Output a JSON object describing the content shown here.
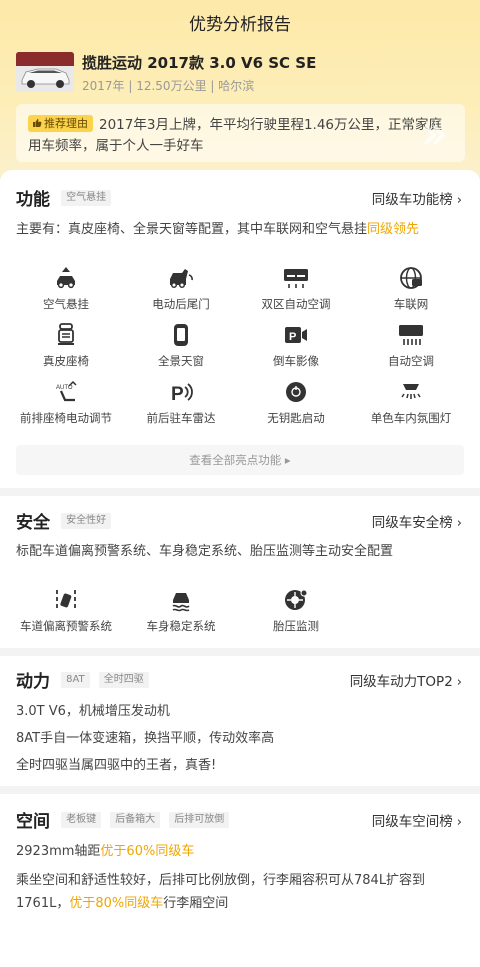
{
  "page": {
    "title": "优势分析报告"
  },
  "car": {
    "name": "揽胜运动 2017款 3.0 V6 SC SE",
    "meta": "2017年 | 12.50万公里 | 哈尔滨"
  },
  "reason": {
    "tag": "推荐理由",
    "text": "2017年3月上牌，年平均行驶里程1.46万公里，正常家庭用车频率，属于个人一手好车"
  },
  "sections": {
    "function": {
      "title": "功能",
      "chips": [
        "空气悬挂"
      ],
      "rank": "同级车功能榜",
      "desc_prefix": "主要有：真皮座椅、全景天窗等配置，其中车联网和空气悬挂",
      "desc_highlight": "同级领先",
      "items": [
        {
          "label": "空气悬挂",
          "icon": "air-suspension-icon"
        },
        {
          "label": "电动后尾门",
          "icon": "power-tailgate-icon"
        },
        {
          "label": "双区自动空调",
          "icon": "dual-zone-ac-icon"
        },
        {
          "label": "车联网",
          "icon": "connected-car-icon"
        },
        {
          "label": "真皮座椅",
          "icon": "leather-seat-icon"
        },
        {
          "label": "全景天窗",
          "icon": "panoramic-sunroof-icon"
        },
        {
          "label": "倒车影像",
          "icon": "reverse-camera-icon"
        },
        {
          "label": "自动空调",
          "icon": "auto-ac-icon"
        },
        {
          "label": "前排座椅电动调节",
          "icon": "power-seat-icon"
        },
        {
          "label": "前后驻车雷达",
          "icon": "parking-radar-icon"
        },
        {
          "label": "无钥匙启动",
          "icon": "keyless-start-icon"
        },
        {
          "label": "单色车内氛围灯",
          "icon": "ambient-light-icon"
        }
      ],
      "view_all": "查看全部亮点功能 ▸"
    },
    "safety": {
      "title": "安全",
      "chips": [
        "安全性好"
      ],
      "rank": "同级车安全榜",
      "desc": "标配车道偏离预警系统、车身稳定系统、胎压监测等主动安全配置",
      "items": [
        {
          "label": "车道偏离预警系统",
          "icon": "lane-departure-icon"
        },
        {
          "label": "车身稳定系统",
          "icon": "stability-control-icon"
        },
        {
          "label": "胎压监测",
          "icon": "tire-pressure-icon"
        }
      ]
    },
    "power": {
      "title": "动力",
      "chips": [
        "8AT",
        "全时四驱"
      ],
      "rank": "同级车动力TOP2",
      "lines": [
        "3.0T V6，机械增压发动机",
        "8AT手自一体变速箱，换挡平顺，传动效率高",
        "全时四驱当属四驱中的王者，真香!"
      ]
    },
    "space": {
      "title": "空间",
      "chips": [
        "老板键",
        "后备箱大",
        "后排可放倒"
      ],
      "rank": "同级车空间榜",
      "line1_prefix": "2923mm轴距",
      "line1_highlight": "优于60%同级车",
      "line2_text": "乘坐空间和舒适性较好，后排可比例放倒，行李厢容积可从784L扩容到1761L，",
      "line2_highlight": "优于80%同级车",
      "line2_suffix": "行李厢空间"
    }
  },
  "colors": {
    "accent": "#f0a600",
    "tag": "#fbd34d",
    "header": "#fde9a8"
  }
}
